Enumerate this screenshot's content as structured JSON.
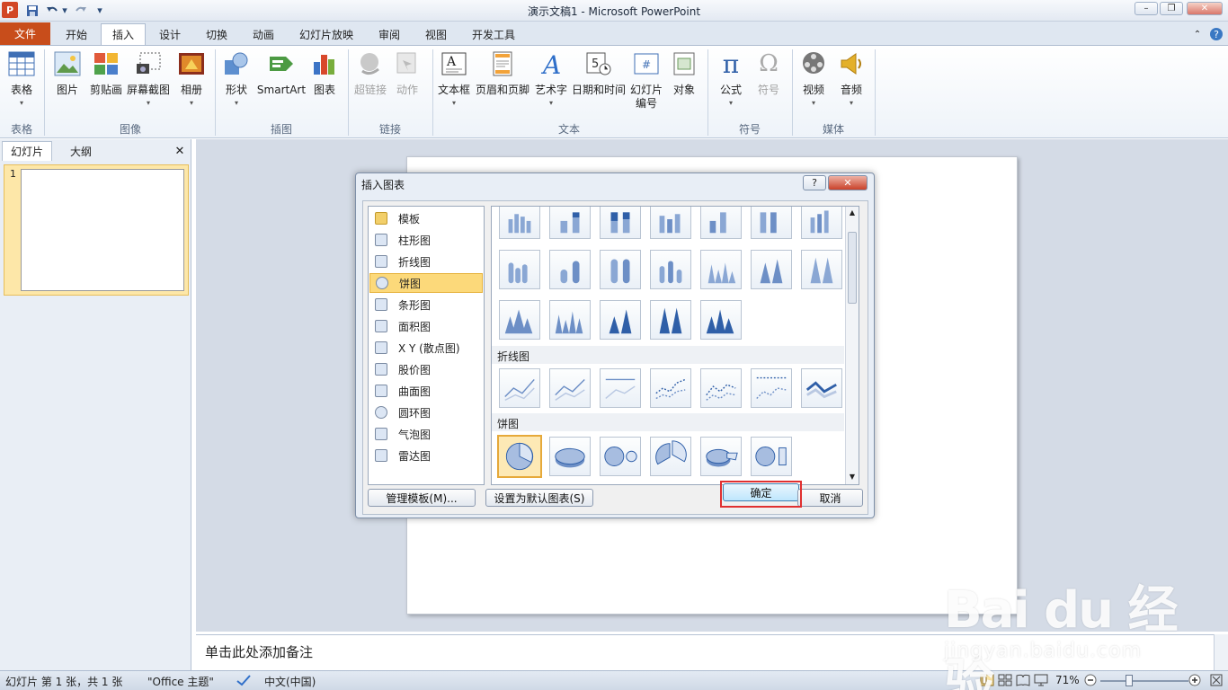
{
  "app": {
    "title": "演示文稿1 - Microsoft PowerPoint",
    "logo": "P"
  },
  "qat": {
    "save": "save-icon",
    "undo": "undo-icon",
    "redo": "redo-icon",
    "customize": "▾"
  },
  "window": {
    "minimize": "–",
    "restore": "❐",
    "close": "✕"
  },
  "tabs": [
    {
      "label": "文件"
    },
    {
      "label": "开始"
    },
    {
      "label": "插入"
    },
    {
      "label": "设计"
    },
    {
      "label": "切换"
    },
    {
      "label": "动画"
    },
    {
      "label": "幻灯片放映"
    },
    {
      "label": "审阅"
    },
    {
      "label": "视图"
    },
    {
      "label": "开发工具"
    }
  ],
  "ribbon": {
    "buttons": {
      "table": "表格",
      "picture": "图片",
      "clipart": "剪贴画",
      "screenshot": "屏幕截图",
      "album": "相册",
      "shapes": "形状",
      "smartart": "SmartArt",
      "chart": "图表",
      "hyperlink": "超链接",
      "action": "动作",
      "textbox": "文本框",
      "header_footer": "页眉和页脚",
      "wordart": "艺术字",
      "datetime": "日期和时间",
      "slide_number": "幻灯片\n编号",
      "object": "对象",
      "equation": "公式",
      "symbol": "符号",
      "video": "视频",
      "audio": "音频"
    },
    "groups": {
      "tables": "表格",
      "images": "图像",
      "illustrations": "插图",
      "links": "链接",
      "text": "文本",
      "symbols": "符号",
      "media": "媒体"
    }
  },
  "left_pane": {
    "tab_slides": "幻灯片",
    "tab_outline": "大纲",
    "close": "✕",
    "slide_number": "1"
  },
  "notes": {
    "placeholder": "单击此处添加备注"
  },
  "status": {
    "slide_info": "幻灯片 第 1 张，共 1 张",
    "theme": "\"Office 主题\"",
    "language": "中文(中国)",
    "zoom": "71%"
  },
  "dialog": {
    "title": "插入图表",
    "help": "?",
    "close": "✕",
    "chart_types": [
      {
        "label": "模板",
        "icon": "folder-icon"
      },
      {
        "label": "柱形图",
        "icon": "column-chart-icon"
      },
      {
        "label": "折线图",
        "icon": "line-chart-icon"
      },
      {
        "label": "饼图",
        "icon": "pie-chart-icon",
        "selected": true
      },
      {
        "label": "条形图",
        "icon": "bar-chart-icon"
      },
      {
        "label": "面积图",
        "icon": "area-chart-icon"
      },
      {
        "label": "X Y (散点图)",
        "icon": "scatter-chart-icon"
      },
      {
        "label": "股价图",
        "icon": "stock-chart-icon"
      },
      {
        "label": "曲面图",
        "icon": "surface-chart-icon"
      },
      {
        "label": "圆环图",
        "icon": "doughnut-chart-icon"
      },
      {
        "label": "气泡图",
        "icon": "bubble-chart-icon"
      },
      {
        "label": "雷达图",
        "icon": "radar-chart-icon"
      }
    ],
    "sections": {
      "line": "折线图",
      "pie": "饼图"
    },
    "buttons": {
      "manage_templates": "管理模板(M)...",
      "set_default": "设置为默认图表(S)",
      "ok": "确定",
      "cancel": "取消"
    }
  },
  "watermark": {
    "logo": "Bai du 经验",
    "url": "jingyan.baidu.com"
  }
}
